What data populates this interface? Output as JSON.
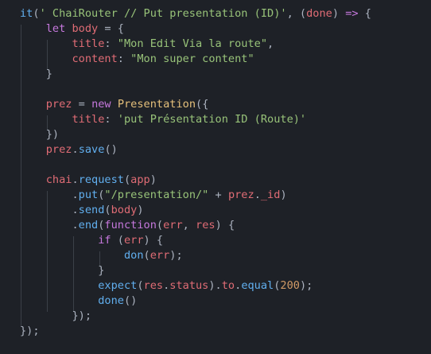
{
  "code": {
    "lines": [
      "it(' ChaiRouter // Put presentation (ID)', (done) => {",
      "    let body = {",
      "        title: \"Mon Edit Via la route\",",
      "        content: \"Mon super content\"",
      "    }",
      "",
      "    prez = new Presentation({",
      "        title: 'put Présentation ID (Route)'",
      "    })",
      "    prez.save()",
      "",
      "    chai.request(app)",
      "        .put(\"/presentation/\" + prez._id)",
      "        .send(body)",
      "        .end(function(err, res) {",
      "            if (err) {",
      "                don(err);",
      "            }",
      "            expect(res.status).to.equal(200);",
      "            done()",
      "        });",
      "});"
    ]
  },
  "theme": {
    "background": "#1e2127",
    "foreground": "#abb2bf",
    "function": "#61afef",
    "keyword": "#c678dd",
    "string": "#98c379",
    "variable": "#e06c75",
    "number": "#d19a66",
    "class": "#e5c07b",
    "operator": "#56b6c2"
  }
}
